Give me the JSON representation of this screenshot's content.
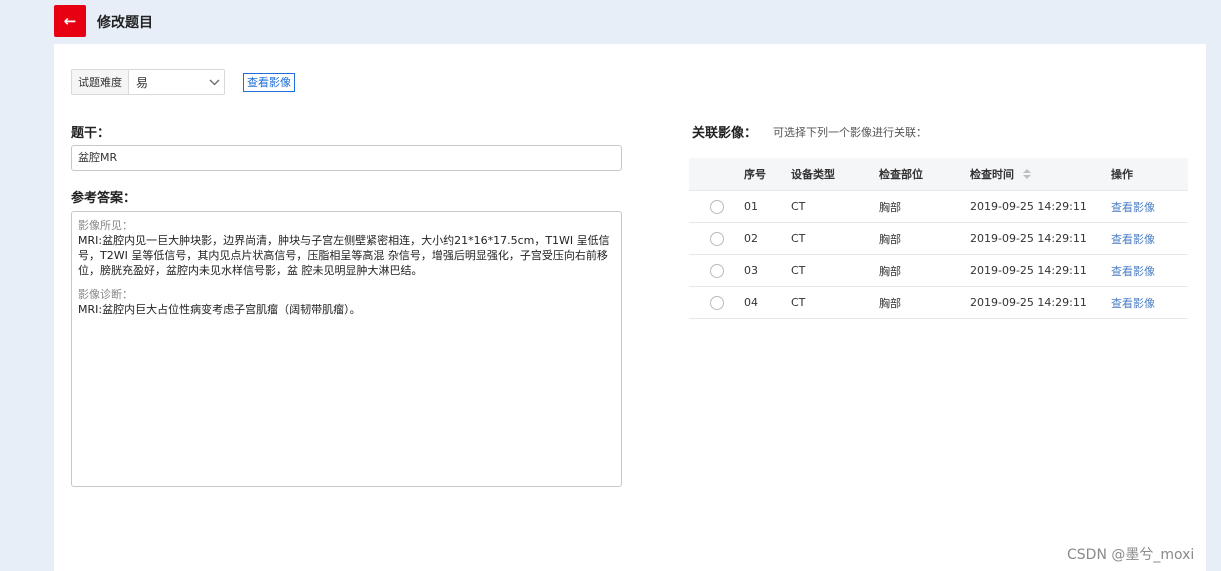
{
  "header": {
    "back_icon": "arrow-left-icon",
    "title": "修改题目",
    "accent_color": "#e60012"
  },
  "difficulty": {
    "label": "试题难度",
    "value": "易",
    "icon": "chevron-down-icon"
  },
  "view_image_link": "查看影像",
  "stem": {
    "label": "题干：",
    "value": "盆腔MR"
  },
  "answer": {
    "label": "参考答案：",
    "findings_label": "影像所见：",
    "findings_text": "MRI:盆腔内见一巨大肿块影，边界尚清，肿块与子宫左侧壁紧密相连，大小约21*16*17.5cm，T1WI 呈低信号，T2WI 呈等低信号，其内见点片状高信号，压脂相呈等高混 杂信号，增强后明显强化，子宫受压向右前移位，膀胱充盈好，盆腔内未见水样信号影，盆 腔未见明显肿大淋巴结。",
    "diagnosis_label": "影像诊断：",
    "diagnosis_text": "MRI:盆腔内巨大占位性病变考虑子宫肌瘤（阔韧带肌瘤）。"
  },
  "related": {
    "label": "关联影像：",
    "hint": "可选择下列一个影像进行关联："
  },
  "table": {
    "columns": [
      "序号",
      "设备类型",
      "检查部位",
      "检查时间",
      "操作"
    ],
    "sort_icon": "sort-icon",
    "rows": [
      {
        "no": "01",
        "device": "CT",
        "part": "胸部",
        "time": "2019-09-25 14:29:11",
        "action": "查看影像"
      },
      {
        "no": "02",
        "device": "CT",
        "part": "胸部",
        "time": "2019-09-25 14:29:11",
        "action": "查看影像"
      },
      {
        "no": "03",
        "device": "CT",
        "part": "胸部",
        "time": "2019-09-25 14:29:11",
        "action": "查看影像"
      },
      {
        "no": "04",
        "device": "CT",
        "part": "胸部",
        "time": "2019-09-25 14:29:11",
        "action": "查看影像"
      }
    ]
  },
  "watermark": "CSDN @墨兮_moxi"
}
